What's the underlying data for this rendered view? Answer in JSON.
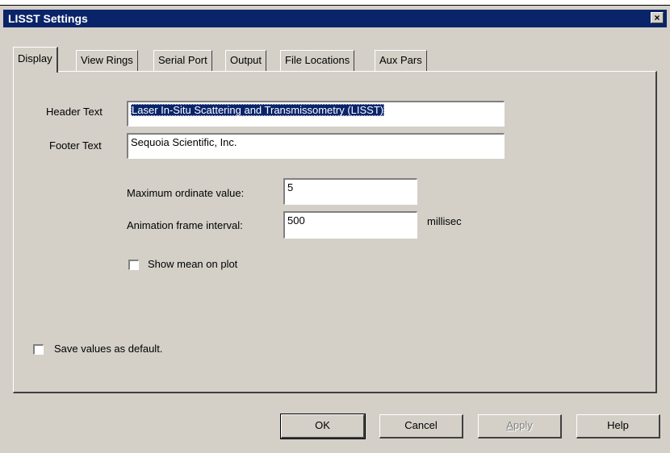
{
  "window": {
    "title": "LISST Settings",
    "close_glyph": "×"
  },
  "tabs": [
    {
      "label": "Display",
      "active": true
    },
    {
      "label": "View Rings"
    },
    {
      "label": "Serial Port"
    },
    {
      "label": "Output"
    },
    {
      "label": "File Locations"
    },
    {
      "label": "Aux Pars"
    }
  ],
  "display": {
    "header_label": "Header Text",
    "header_value": "Laser In-Situ Scattering and Transmissometry (LISST)",
    "footer_label": "Footer Text",
    "footer_value": "Sequoia Scientific, Inc.",
    "max_ordinate_label": "Maximum ordinate value:",
    "max_ordinate_value": "5",
    "anim_interval_label": "Animation frame interval:",
    "anim_interval_value": "500",
    "anim_units": "millisec",
    "show_mean_label": "Show mean on plot",
    "show_mean_checked": false,
    "save_default_label": "Save values as default.",
    "save_default_checked": false
  },
  "buttons": {
    "ok": "OK",
    "cancel": "Cancel",
    "apply_first": "A",
    "apply_rest": "pply",
    "help": "Help"
  }
}
